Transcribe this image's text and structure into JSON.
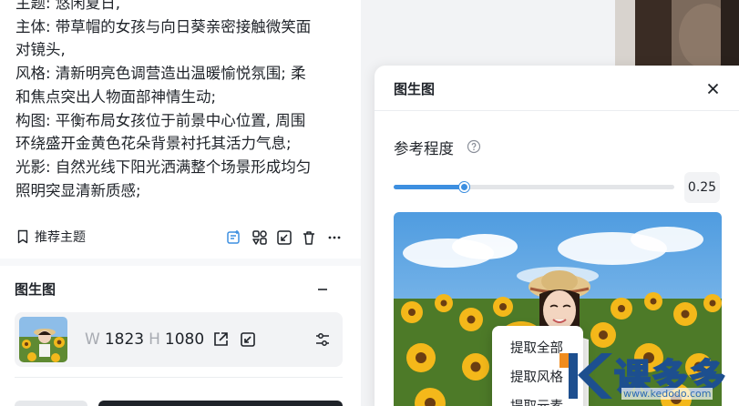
{
  "description": {
    "lines": [
      "主题: 悠闲夏日,",
      "主体: 带草帽的女孩与向日葵亲密接触微笑面",
      "对镜头,",
      "风格: 清新明亮色调营造出温暖愉悦氛围; 柔",
      "和焦点突出人物面部神情生动;",
      "构图: 平衡布局女孩位于前景中心位置, 周围",
      "环绕盛开金黄色花朵背景衬托其活力气息;",
      "光影: 自然光线下阳光洒满整个场景形成均匀",
      "照明突显清新质感;"
    ]
  },
  "toolbar": {
    "recommend_label": "推荐主题",
    "icons": [
      "apply-icon",
      "extract-icon",
      "expand-icon",
      "trash-icon",
      "more-icon"
    ]
  },
  "section": {
    "title": "图生图"
  },
  "reference": {
    "w_label": "W",
    "w_value": "1823",
    "h_label": "H",
    "h_value": "1080"
  },
  "modal": {
    "title": "图生图",
    "strength_label": "参考程度",
    "strength_value": "0.25",
    "strength_fraction": 0.25
  },
  "context_menu": {
    "items": [
      "提取全部",
      "提取风格",
      "提取元素"
    ]
  },
  "watermark": {
    "text": "课多多",
    "url": "www.kedodo.com"
  },
  "colors": {
    "accent": "#3d8fe0",
    "watermark_orange": "#f08c1e",
    "watermark_blue": "#1d4f8f"
  }
}
